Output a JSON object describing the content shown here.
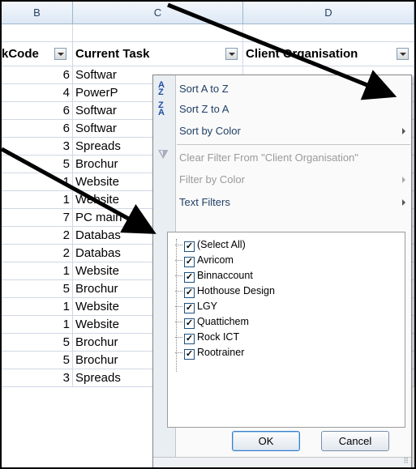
{
  "columns": {
    "b": "B",
    "c": "C",
    "d": "D"
  },
  "header_row": {
    "b": "kCode",
    "c": "Current Task",
    "d": "Client Organisation"
  },
  "rows": [
    {
      "code": "6",
      "task": "Softwar"
    },
    {
      "code": "4",
      "task": "PowerP"
    },
    {
      "code": "6",
      "task": "Softwar"
    },
    {
      "code": "6",
      "task": "Softwar"
    },
    {
      "code": "3",
      "task": "Spreads"
    },
    {
      "code": "5",
      "task": "Brochur"
    },
    {
      "code": "1",
      "task": "Website"
    },
    {
      "code": "1",
      "task": "Website"
    },
    {
      "code": "7",
      "task": "PC main"
    },
    {
      "code": "2",
      "task": "Databas"
    },
    {
      "code": "2",
      "task": "Databas"
    },
    {
      "code": "1",
      "task": "Website"
    },
    {
      "code": "5",
      "task": "Brochur"
    },
    {
      "code": "1",
      "task": "Website"
    },
    {
      "code": "1",
      "task": "Website"
    },
    {
      "code": "5",
      "task": "Brochur"
    },
    {
      "code": "5",
      "task": "Brochur"
    },
    {
      "code": "3",
      "task": "Spreads"
    }
  ],
  "menu": {
    "sort_az": "Sort A to Z",
    "sort_za": "Sort Z to A",
    "sort_by_color": "Sort by Color",
    "clear_filter": "Clear Filter From \"Client Organisation\"",
    "filter_by_color": "Filter by Color",
    "text_filters": "Text Filters",
    "icon_az": "A\nZ",
    "icon_za": "Z\nA"
  },
  "filter_list": [
    {
      "label": "(Select All)",
      "checked": true
    },
    {
      "label": "Avricom",
      "checked": true
    },
    {
      "label": "Binnaccount",
      "checked": true
    },
    {
      "label": "Hothouse Design",
      "checked": true
    },
    {
      "label": "LGY",
      "checked": true
    },
    {
      "label": "Quattichem",
      "checked": true
    },
    {
      "label": "Rock ICT",
      "checked": true
    },
    {
      "label": "Rootrainer",
      "checked": true
    }
  ],
  "buttons": {
    "ok": "OK",
    "cancel": "Cancel"
  },
  "colors": {
    "header_text": "#27415f",
    "menu_text": "#1f3f66",
    "disabled": "#9a9a9a"
  }
}
